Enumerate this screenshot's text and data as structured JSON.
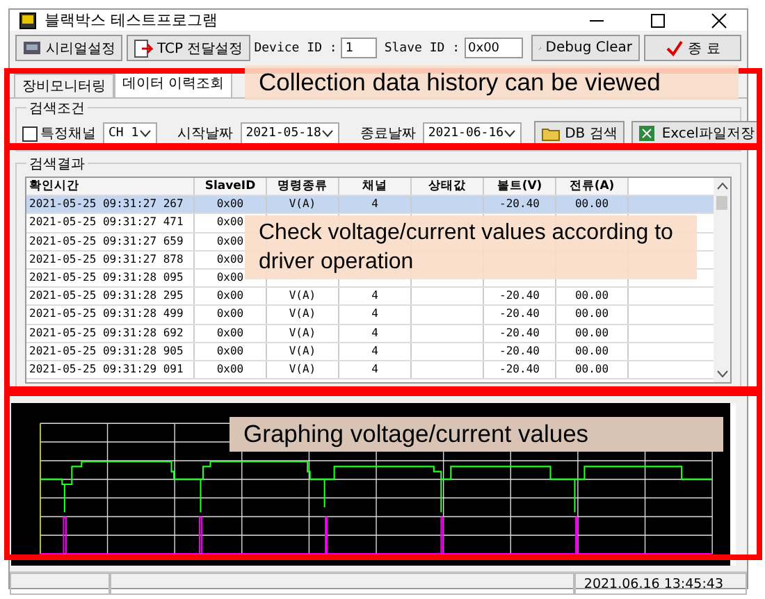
{
  "window": {
    "title": "블랙박스 테스트프로그램"
  },
  "toolbar": {
    "buttons": [
      {
        "label": "시리얼설정",
        "kind": "serial"
      },
      {
        "label": "TCP 전달설정",
        "kind": "tcp"
      }
    ],
    "fields": [
      {
        "label": "Device ID :",
        "value": "1"
      },
      {
        "label": "Slave ID :",
        "value": "0x00"
      }
    ],
    "debug_button": "Debug Clear",
    "exit_button": "종 료"
  },
  "tabs": [
    {
      "label": "장비모니터링",
      "selected": false
    },
    {
      "label": "데이터 이력조회",
      "selected": true
    }
  ],
  "search": {
    "title": "검색조건",
    "channel_filter": {
      "label": "특정채널",
      "checked": false
    },
    "channel": "CH 1",
    "start": {
      "label": "시작날짜",
      "value": "2021-05-18"
    },
    "end": {
      "label": "종료날짜",
      "value": "2021-06-16"
    },
    "search_button": "DB 검색",
    "export_button": "Excel파일저장"
  },
  "results": {
    "title": "검색결과",
    "columns": [
      "확인시간",
      "SlaveID",
      "명령종류",
      "채널",
      "상태값",
      "볼트(V)",
      "전류(A)"
    ],
    "rows": [
      {
        "selected": true,
        "cells": [
          "2021-05-25 09:31:27 267",
          "0x00",
          "V(A)",
          "4",
          "",
          "-20.40",
          "00.00"
        ]
      },
      {
        "selected": false,
        "cells": [
          "2021-05-25 09:31:27 471",
          "0x00"
        ]
      },
      {
        "selected": false,
        "cells": [
          "2021-05-25 09:31:27 659",
          "0x00"
        ]
      },
      {
        "selected": false,
        "cells": [
          "2021-05-25 09:31:27 878",
          "0x00"
        ]
      },
      {
        "selected": false,
        "cells": [
          "2021-05-25 09:31:28 095",
          "0x00"
        ]
      },
      {
        "selected": false,
        "cells": [
          "2021-05-25 09:31:28 295",
          "0x00",
          "V(A)",
          "4",
          "",
          "-20.40",
          "00.00"
        ]
      },
      {
        "selected": false,
        "cells": [
          "2021-05-25 09:31:28 499",
          "0x00",
          "V(A)",
          "4",
          "",
          "-20.40",
          "00.00"
        ]
      },
      {
        "selected": false,
        "cells": [
          "2021-05-25 09:31:28 692",
          "0x00",
          "V(A)",
          "4",
          "",
          "-20.40",
          "00.00"
        ]
      },
      {
        "selected": false,
        "cells": [
          "2021-05-25 09:31:28 905",
          "0x00",
          "V(A)",
          "4",
          "",
          "-20.40",
          "00.00"
        ]
      },
      {
        "selected": false,
        "cells": [
          "2021-05-25 09:31:29 091",
          "0x00",
          "V(A)",
          "4",
          "",
          "-20.40",
          "00.00"
        ]
      }
    ]
  },
  "status_bar": {
    "time": "2021.06.16 13:45:43"
  },
  "annotations": [
    {
      "text": "Collection data history can be viewed",
      "kind": "tabs"
    },
    {
      "text": "Check voltage/current values according to driver operation",
      "kind": "table"
    },
    {
      "text": "Graphing voltage/current values",
      "kind": "graph"
    }
  ]
}
